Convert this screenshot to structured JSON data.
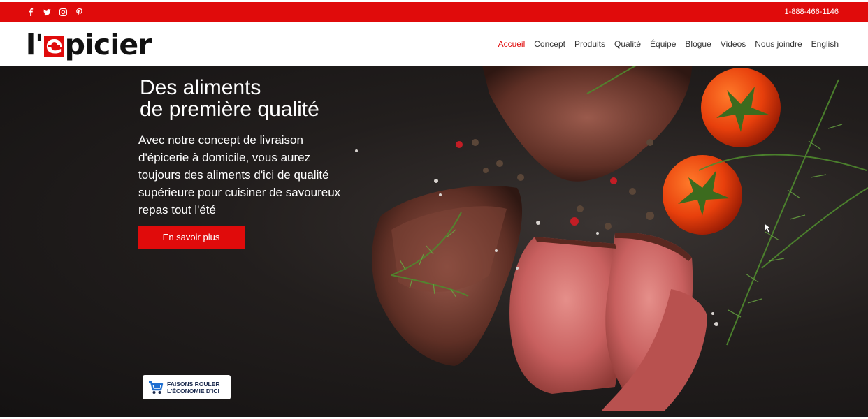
{
  "topbar": {
    "social_icons": [
      "facebook-icon",
      "twitter-icon",
      "instagram-icon",
      "pinterest-icon"
    ],
    "phone": "1-888-466-1146",
    "color": "#e00b0b"
  },
  "header": {
    "logo": {
      "prefix": "l'",
      "e_letter": "e",
      "suffix": "picier"
    },
    "nav": [
      {
        "label": "Accueil",
        "active": true
      },
      {
        "label": "Concept"
      },
      {
        "label": "Produits"
      },
      {
        "label": "Qualité"
      },
      {
        "label": "Équipe"
      },
      {
        "label": "Blogue"
      },
      {
        "label": "Videos"
      },
      {
        "label": "Nous joindre"
      },
      {
        "label": "English"
      }
    ]
  },
  "hero": {
    "title_line1": "Des aliments",
    "title_line2": "de première qualité",
    "text": "Avec notre concept de livraison d'épicerie à domicile, vous aurez toujours des aliments d'ici de qualité supérieure pour cuisiner de savoureux repas tout l'été",
    "cta_label": "En savoir plus",
    "badge_line1": "FAISONS ROULER",
    "badge_line2": "L'ÉCONOMIE D'ICI"
  }
}
